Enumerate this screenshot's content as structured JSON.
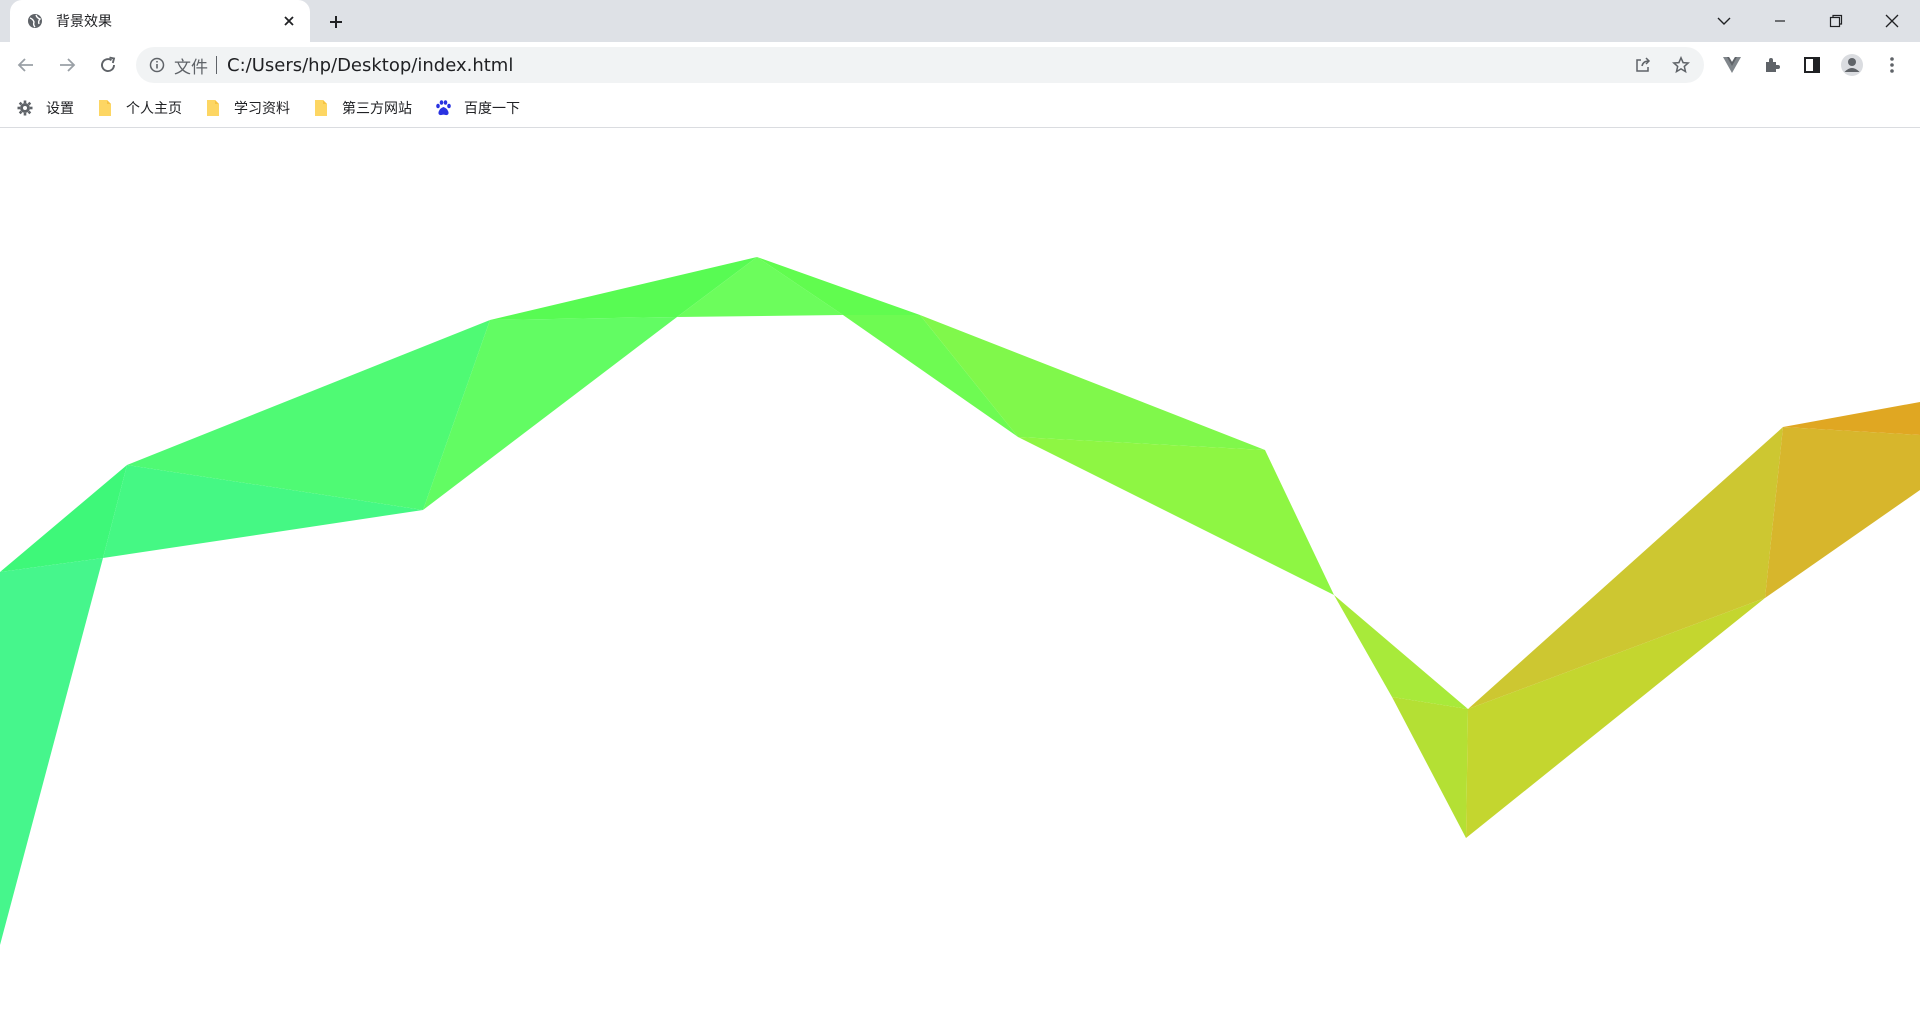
{
  "browser": {
    "tab": {
      "title": "背景效果",
      "favicon": "globe-icon"
    },
    "toolbar": {
      "omnibox": {
        "scheme_label": "文件",
        "url": "C:/Users/hp/Desktop/index.html"
      }
    },
    "bookmarks": [
      {
        "label": "设置",
        "icon": "gear-icon"
      },
      {
        "label": "个人主页",
        "icon": "folder-icon"
      },
      {
        "label": "学习资料",
        "icon": "folder-icon"
      },
      {
        "label": "第三方网站",
        "icon": "folder-icon"
      },
      {
        "label": "百度一下",
        "icon": "baidu-paw-icon"
      }
    ]
  },
  "colors": {
    "tab_strip": "#dee1e6",
    "omnibox_bg": "#f1f3f4",
    "folder_yellow": "#fdd663",
    "baidu_blue": "#2932e1",
    "ribbon_green": "#4dfb76",
    "ribbon_lime": "#8ff542",
    "ribbon_gold": "#d9b22a"
  }
}
